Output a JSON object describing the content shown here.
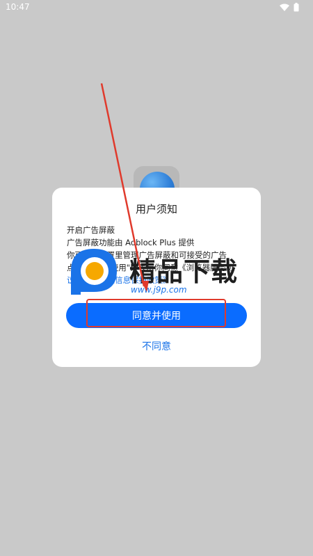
{
  "status_bar": {
    "time": "10:47"
  },
  "dialog": {
    "title": "用户须知",
    "lines": [
      "开启广告屏蔽",
      "广告屏蔽功能由 Adblock Plus 提供",
      "你可以在设置里管理广告屏蔽和可接受的广告",
      "点击\"同意并使用\"即表示你同意《浏览器服务协",
      "议》及《个人信息保护政策》"
    ],
    "agree_label": "同意并使用",
    "disagree_label": "不同意"
  },
  "watermark": {
    "brand": "精品下载",
    "url": "www.j9p.com"
  },
  "colors": {
    "accent": "#0a6cff",
    "link": "#1a73e8",
    "annotation": "#e03a2c",
    "backdrop": "#c9c9c9"
  },
  "icons": [
    "wifi-icon",
    "battery-icon",
    "browser-app-icon"
  ]
}
